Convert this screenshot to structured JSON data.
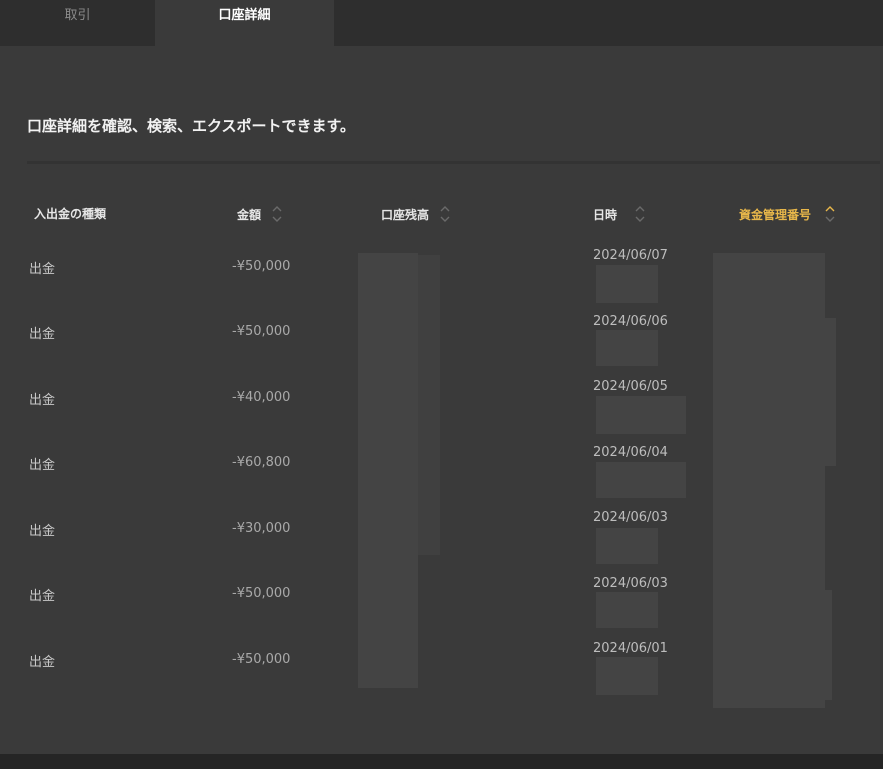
{
  "tabs": [
    {
      "label": "取引"
    },
    {
      "label": "口座詳細"
    }
  ],
  "description": "口座詳細を確認、検索、エクスポートできます。",
  "table": {
    "columns": [
      {
        "label": "入出金の種類",
        "sortable": false
      },
      {
        "label": "金額",
        "sortable": true
      },
      {
        "label": "口座残高",
        "sortable": true
      },
      {
        "label": "日時",
        "sortable": true
      },
      {
        "label": "資金管理番号",
        "sortable": true,
        "active": true
      }
    ],
    "rows": [
      {
        "type": "出金",
        "amount": "-¥50,000",
        "date": "2024/06/07"
      },
      {
        "type": "出金",
        "amount": "-¥50,000",
        "date": "2024/06/06"
      },
      {
        "type": "出金",
        "amount": "-¥40,000",
        "date": "2024/06/05"
      },
      {
        "type": "出金",
        "amount": "-¥60,800",
        "date": "2024/06/04"
      },
      {
        "type": "出金",
        "amount": "-¥30,000",
        "date": "2024/06/03"
      },
      {
        "type": "出金",
        "amount": "-¥50,000",
        "date": "2024/06/03"
      },
      {
        "type": "出金",
        "amount": "-¥50,000",
        "date": "2024/06/01"
      }
    ]
  },
  "colors": {
    "background": "#3a3a3a",
    "tabbar": "#2e2e2e",
    "active_header": "#e8b74a",
    "text": "#c8c8c8"
  }
}
